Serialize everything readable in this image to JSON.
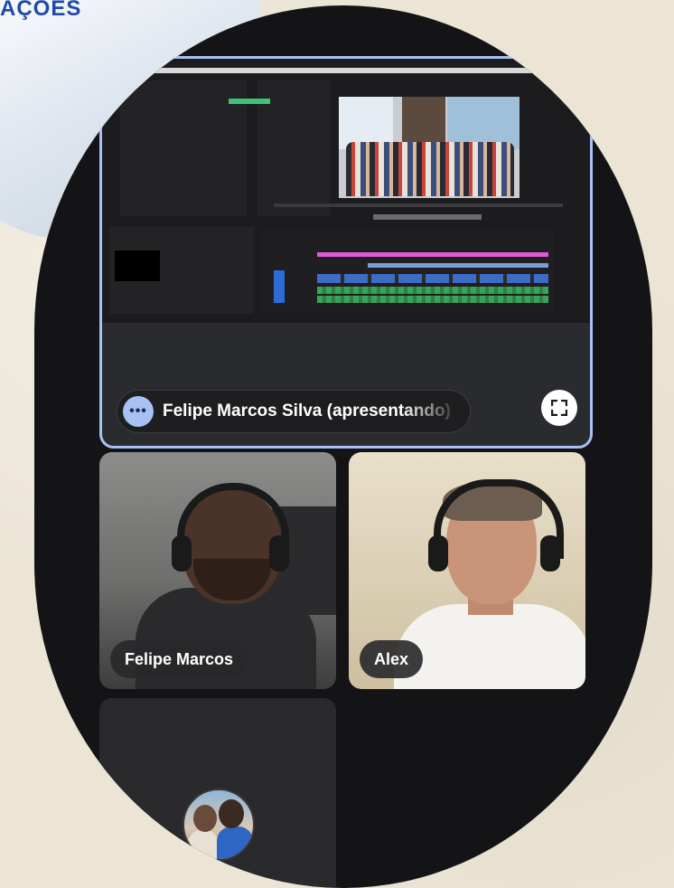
{
  "brand": {
    "text": "AÇÕES"
  },
  "presenter": {
    "name": "Felipe Marcos Silva (apresentando)",
    "menu_label": "•••"
  },
  "participants": [
    {
      "name": "Felipe Marcos"
    },
    {
      "name": "Alex"
    }
  ],
  "colors": {
    "background": "#ece5d6",
    "phone": "#141416",
    "accent": "#a8c1f2",
    "brand": "#1f4aa8"
  },
  "icons": [
    "more-options-icon",
    "fullscreen-icon",
    "avatar"
  ]
}
